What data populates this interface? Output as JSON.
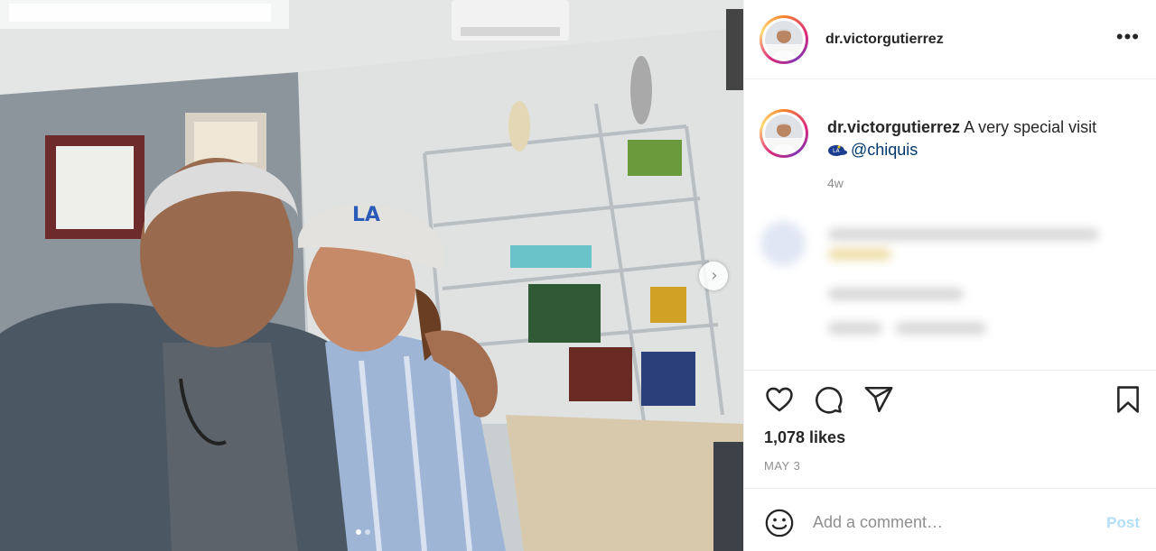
{
  "post": {
    "username": "dr.victorgutierrez",
    "more_icon": "more-horizontal-icon",
    "caption_text": "A very special visit",
    "caption_mention": "@chiquis",
    "caption_emoji": "la-dodgers-cap-emoji",
    "age": "4w",
    "likes": "1,078 likes",
    "date": "MAY 3",
    "carousel": {
      "current": 1,
      "total": 2
    }
  },
  "actions": {
    "like_icon": "heart-icon",
    "comment_icon": "comment-icon",
    "share_icon": "paper-plane-icon",
    "save_icon": "bookmark-icon"
  },
  "comment_box": {
    "placeholder": "Add a comment…",
    "post_label": "Post",
    "emoji_icon": "smiley-icon"
  },
  "colors": {
    "mention": "#00376b",
    "muted": "#8e8e8e",
    "post_disabled": "#b2dffc",
    "story_ring": "#dd2a7b"
  }
}
